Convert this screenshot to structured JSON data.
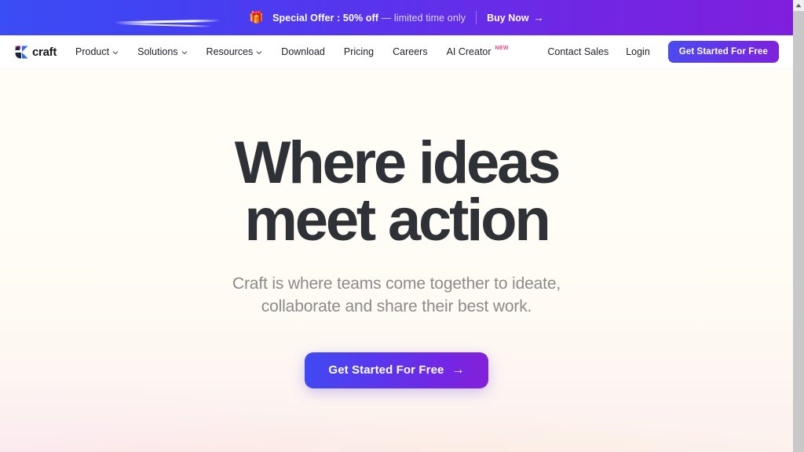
{
  "promo": {
    "icon": "gift-icon",
    "prefix": "Special Offer : 50% off",
    "separator": " — ",
    "suffix": "limited time only",
    "cta_label": "Buy Now",
    "cta_arrow": "→",
    "gradient_start": "#3b4df5",
    "gradient_end": "#7f1fdd"
  },
  "nav": {
    "brand": "craft",
    "links": [
      {
        "label": "Product",
        "has_chevron": true,
        "badge": ""
      },
      {
        "label": "Solutions",
        "has_chevron": true,
        "badge": ""
      },
      {
        "label": "Resources",
        "has_chevron": true,
        "badge": ""
      },
      {
        "label": "Download",
        "has_chevron": false,
        "badge": ""
      },
      {
        "label": "Pricing",
        "has_chevron": false,
        "badge": ""
      },
      {
        "label": "Careers",
        "has_chevron": false,
        "badge": ""
      },
      {
        "label": "AI Creator",
        "has_chevron": false,
        "badge": "NEW"
      }
    ],
    "contact_sales": "Contact Sales",
    "login": "Login",
    "cta_label": "Get Started For Free",
    "badge_color": "#f4418f"
  },
  "hero": {
    "headline_line1": "Where ideas",
    "headline_line2": "meet action",
    "subhead_line1": "Craft is where teams come together to ideate,",
    "subhead_line2": "collaborate and share their best work.",
    "cta_label": "Get Started For Free",
    "cta_arrow": "→",
    "background_top": "#fffdf6",
    "background_bottom": "#fbf0ee",
    "cta_gradient_start": "#3f4bf2",
    "cta_gradient_end": "#8420d8"
  },
  "scrollbar": {
    "up_arrow": "scroll-up-arrow"
  }
}
